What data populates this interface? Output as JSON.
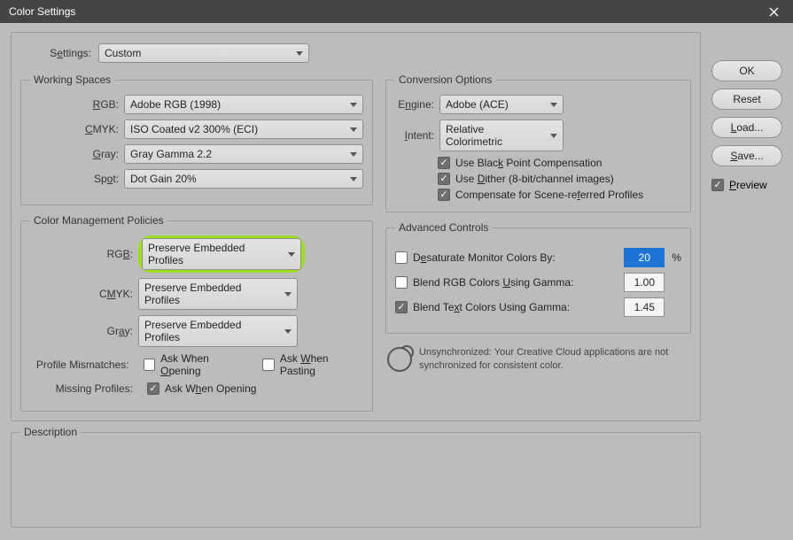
{
  "titlebar": {
    "title": "Color Settings"
  },
  "settings": {
    "label": "Settings:",
    "value": "Custom"
  },
  "working_spaces": {
    "legend": "Working Spaces",
    "rgb_label": "RGB:",
    "rgb_value": "Adobe RGB (1998)",
    "cmyk_label": "CMYK:",
    "cmyk_value": "ISO Coated v2 300% (ECI)",
    "gray_label": "Gray:",
    "gray_value": "Gray Gamma 2.2",
    "spot_label": "Spot:",
    "spot_value": "Dot Gain 20%"
  },
  "policies": {
    "legend": "Color Management Policies",
    "rgb_label": "RGB:",
    "rgb_value": "Preserve Embedded Profiles",
    "cmyk_label": "CMYK:",
    "cmyk_value": "Preserve Embedded Profiles",
    "gray_label": "Gray:",
    "gray_value": "Preserve Embedded Profiles",
    "mismatch_label": "Profile Mismatches:",
    "mismatch_open": "Ask When Opening",
    "mismatch_paste": "Ask When Pasting",
    "missing_label": "Missing Profiles:",
    "missing_open": "Ask When Opening"
  },
  "conversion": {
    "legend": "Conversion Options",
    "engine_label": "Engine:",
    "engine_value": "Adobe (ACE)",
    "intent_label": "Intent:",
    "intent_value": "Relative Colorimetric",
    "bpc": "Use Black Point Compensation",
    "dither": "Use Dither (8-bit/channel images)",
    "scene": "Compensate for Scene-referred Profiles"
  },
  "advanced": {
    "legend": "Advanced Controls",
    "desat_label": "Desaturate Monitor Colors By:",
    "desat_value": "20",
    "desat_pct": "%",
    "blend_rgb_label": "Blend RGB Colors Using Gamma:",
    "blend_rgb_value": "1.00",
    "blend_text_label": "Blend Text Colors Using Gamma:",
    "blend_text_value": "1.45"
  },
  "sync": {
    "text": "Unsynchronized: Your Creative Cloud applications are not synchronized for consistent color."
  },
  "description": {
    "legend": "Description"
  },
  "buttons": {
    "ok": "OK",
    "reset": "Reset",
    "load": "Load...",
    "save": "Save...",
    "preview": "Preview"
  }
}
